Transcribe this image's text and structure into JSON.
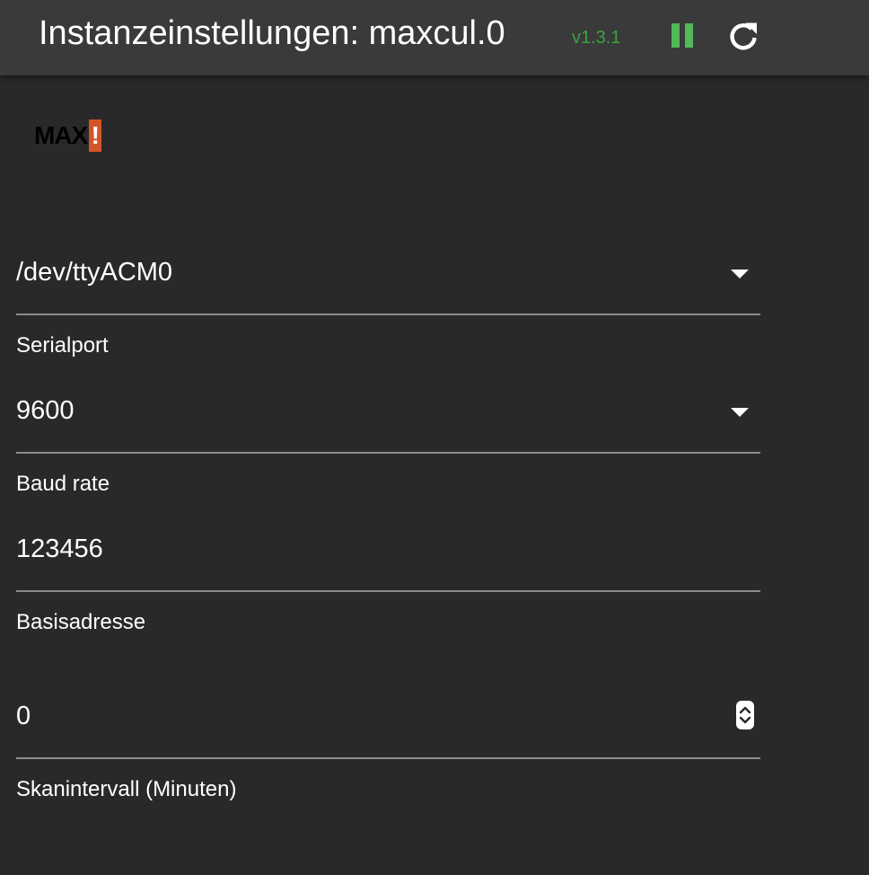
{
  "header": {
    "title": "Instanzeinstellungen: maxcul.0",
    "version": "v1.3.1",
    "pause_icon": "pause-icon",
    "reload_icon": "reload-icon",
    "colors": {
      "version": "#3aa33e",
      "pause": "#52b95a",
      "background": "#3a3a3a"
    }
  },
  "logo": {
    "text": "MAX",
    "bang": "!",
    "bang_color": "#d4542a"
  },
  "form": {
    "serialport": {
      "value": "/dev/ttyACM0",
      "label": "Serialport"
    },
    "baud_rate": {
      "value": "9600",
      "label": "Baud rate"
    },
    "base_address": {
      "value": "123456",
      "label": "Basisadresse"
    },
    "scan_interval": {
      "value": "0",
      "label": "Skanintervall (Minuten)"
    }
  }
}
